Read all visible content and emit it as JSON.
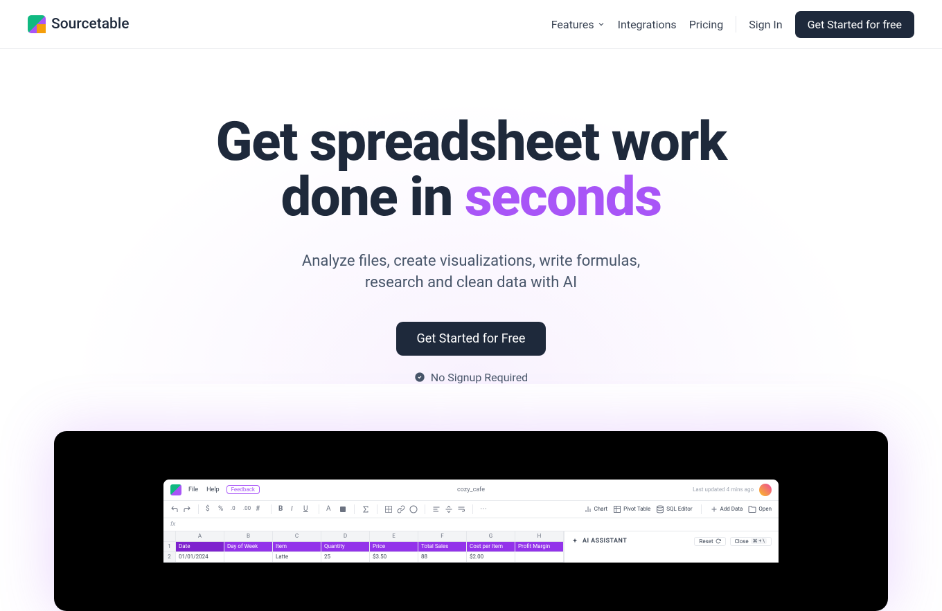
{
  "nav": {
    "brand": "Sourcetable",
    "links": {
      "features": "Features",
      "integrations": "Integrations",
      "pricing": "Pricing",
      "signin": "Sign In"
    },
    "cta": "Get Started for free"
  },
  "hero": {
    "title_line1": "Get spreadsheet work",
    "title_line2_pre": "done in ",
    "title_line2_highlight": "seconds",
    "subtitle": "Analyze files, create visualizations, write formulas, research and clean data with AI",
    "cta": "Get Started for Free",
    "note": "No Signup Required"
  },
  "app": {
    "menu": {
      "file": "File",
      "help": "Help",
      "feedback": "Feedback"
    },
    "title": "cozy_cafe",
    "updated": "Last updated 4 mins ago",
    "toolbar": {
      "chart": "Chart",
      "pivot": "Pivot Table",
      "sql": "SQL Editor",
      "add_data": "Add Data",
      "open": "Open"
    },
    "formula_prefix": "fx",
    "columns": [
      "A",
      "B",
      "C",
      "D",
      "E",
      "F",
      "G",
      "H"
    ],
    "headers": [
      "Date",
      "Day of Week",
      "Item",
      "Quantity",
      "Price",
      "Total Sales",
      "Cost per Item",
      "Profit Margin"
    ],
    "rows": [
      {
        "num": "2",
        "cells": [
          "01/01/2024",
          "",
          "Latte",
          "25",
          "$3.50",
          "88",
          "$2.00",
          ""
        ]
      }
    ],
    "ai": {
      "title": "AI ASSISTANT",
      "reset": "Reset",
      "close": "Close",
      "shortcut": "⌘ + \\"
    }
  }
}
